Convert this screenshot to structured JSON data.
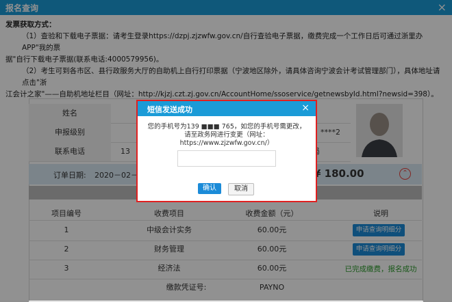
{
  "window": {
    "title": "报名查询",
    "close": "×"
  },
  "notice": {
    "heading": "发票获取方式：",
    "item1_line1": "（1）查验和下载电子票据：请考生登录https://dzpj.zjzwfw.gov.cn/自行查验电子票据，缴费完成一个工作日后可通过浙里办APP\"我的票",
    "item1_line2": "据\"自行下载电子票据(联系电话:4000579956)。",
    "item2_line1": "（2）考生可到各市区、县行政服务大厅的自助机上自行打印票据（宁波地区除外，请具体咨询宁波会计考试管理部门），具体地址请点击\"浙",
    "item2_line2": "江会计之家\"——自助机地址栏目（网址：http://kjzj.czt.zj.gov.cn/AccountHome/ssoservice/getnewsbyId.html?newsid=398）。"
  },
  "info": {
    "name_label": "姓名",
    "level_label": "申报级别",
    "level_value_partial": "****2",
    "phone_label": "联系电话",
    "phone_value_partial": "13",
    "extra_partial": "局"
  },
  "order": {
    "date_label": "订单日期:",
    "date_value": "2020－02－26",
    "amount": "¥ 180.00",
    "toggle_icon": "⌃"
  },
  "table": {
    "headers": [
      "项目编号",
      "收费项目",
      "收费金额（元）",
      "说明"
    ],
    "rows": [
      {
        "no": "1",
        "item": "中级会计实务",
        "amount": "60.00元",
        "action": "申请查询明细分"
      },
      {
        "no": "2",
        "item": "财务管理",
        "amount": "60.00元",
        "action": "申请查询明细分"
      },
      {
        "no": "3",
        "item": "经济法",
        "amount": "60.00元",
        "status": "已完成缴费，报名成功"
      }
    ],
    "voucher_label": "缴款凭证号:",
    "voucher_value": "PAYNO"
  },
  "modal": {
    "title": "短信发送成功",
    "close": "×",
    "message_line1": "您的手机号为139 ■■■ 765，如您的手机号需更改，",
    "message_line2": "请至政务网进行变更（网址：",
    "message_line3": "https://www.zjzwfw.gov.cn/）",
    "input_value": "",
    "confirm_label": "确认",
    "cancel_label": "取消"
  },
  "colors": {
    "header_blue": "#1b9bd7",
    "button_blue": "#1b8bd8",
    "highlight_red": "#e02020",
    "success_green": "#2c9b2c"
  }
}
